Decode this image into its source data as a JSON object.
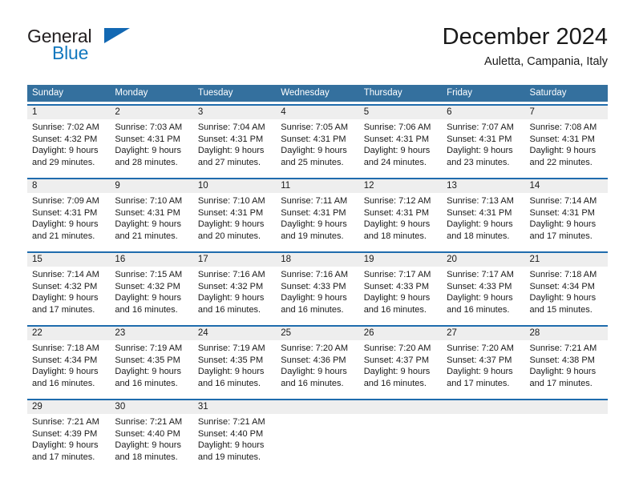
{
  "brand": {
    "name_part1": "General",
    "name_part2": "Blue",
    "accent_color": "#1278be",
    "triangle_color": "#1268b3"
  },
  "header": {
    "title": "December 2024",
    "location": "Auletta, Campania, Italy"
  },
  "theme": {
    "header_bg": "#34709e",
    "week_border": "#1f6cad",
    "daynum_bg": "#eeeeee"
  },
  "weekday_headers": [
    "Sunday",
    "Monday",
    "Tuesday",
    "Wednesday",
    "Thursday",
    "Friday",
    "Saturday"
  ],
  "weeks": [
    {
      "days": [
        {
          "num": "1",
          "sunrise": "Sunrise: 7:02 AM",
          "sunset": "Sunset: 4:32 PM",
          "daylight1": "Daylight: 9 hours",
          "daylight2": "and 29 minutes."
        },
        {
          "num": "2",
          "sunrise": "Sunrise: 7:03 AM",
          "sunset": "Sunset: 4:31 PM",
          "daylight1": "Daylight: 9 hours",
          "daylight2": "and 28 minutes."
        },
        {
          "num": "3",
          "sunrise": "Sunrise: 7:04 AM",
          "sunset": "Sunset: 4:31 PM",
          "daylight1": "Daylight: 9 hours",
          "daylight2": "and 27 minutes."
        },
        {
          "num": "4",
          "sunrise": "Sunrise: 7:05 AM",
          "sunset": "Sunset: 4:31 PM",
          "daylight1": "Daylight: 9 hours",
          "daylight2": "and 25 minutes."
        },
        {
          "num": "5",
          "sunrise": "Sunrise: 7:06 AM",
          "sunset": "Sunset: 4:31 PM",
          "daylight1": "Daylight: 9 hours",
          "daylight2": "and 24 minutes."
        },
        {
          "num": "6",
          "sunrise": "Sunrise: 7:07 AM",
          "sunset": "Sunset: 4:31 PM",
          "daylight1": "Daylight: 9 hours",
          "daylight2": "and 23 minutes."
        },
        {
          "num": "7",
          "sunrise": "Sunrise: 7:08 AM",
          "sunset": "Sunset: 4:31 PM",
          "daylight1": "Daylight: 9 hours",
          "daylight2": "and 22 minutes."
        }
      ]
    },
    {
      "days": [
        {
          "num": "8",
          "sunrise": "Sunrise: 7:09 AM",
          "sunset": "Sunset: 4:31 PM",
          "daylight1": "Daylight: 9 hours",
          "daylight2": "and 21 minutes."
        },
        {
          "num": "9",
          "sunrise": "Sunrise: 7:10 AM",
          "sunset": "Sunset: 4:31 PM",
          "daylight1": "Daylight: 9 hours",
          "daylight2": "and 21 minutes."
        },
        {
          "num": "10",
          "sunrise": "Sunrise: 7:10 AM",
          "sunset": "Sunset: 4:31 PM",
          "daylight1": "Daylight: 9 hours",
          "daylight2": "and 20 minutes."
        },
        {
          "num": "11",
          "sunrise": "Sunrise: 7:11 AM",
          "sunset": "Sunset: 4:31 PM",
          "daylight1": "Daylight: 9 hours",
          "daylight2": "and 19 minutes."
        },
        {
          "num": "12",
          "sunrise": "Sunrise: 7:12 AM",
          "sunset": "Sunset: 4:31 PM",
          "daylight1": "Daylight: 9 hours",
          "daylight2": "and 18 minutes."
        },
        {
          "num": "13",
          "sunrise": "Sunrise: 7:13 AM",
          "sunset": "Sunset: 4:31 PM",
          "daylight1": "Daylight: 9 hours",
          "daylight2": "and 18 minutes."
        },
        {
          "num": "14",
          "sunrise": "Sunrise: 7:14 AM",
          "sunset": "Sunset: 4:31 PM",
          "daylight1": "Daylight: 9 hours",
          "daylight2": "and 17 minutes."
        }
      ]
    },
    {
      "days": [
        {
          "num": "15",
          "sunrise": "Sunrise: 7:14 AM",
          "sunset": "Sunset: 4:32 PM",
          "daylight1": "Daylight: 9 hours",
          "daylight2": "and 17 minutes."
        },
        {
          "num": "16",
          "sunrise": "Sunrise: 7:15 AM",
          "sunset": "Sunset: 4:32 PM",
          "daylight1": "Daylight: 9 hours",
          "daylight2": "and 16 minutes."
        },
        {
          "num": "17",
          "sunrise": "Sunrise: 7:16 AM",
          "sunset": "Sunset: 4:32 PM",
          "daylight1": "Daylight: 9 hours",
          "daylight2": "and 16 minutes."
        },
        {
          "num": "18",
          "sunrise": "Sunrise: 7:16 AM",
          "sunset": "Sunset: 4:33 PM",
          "daylight1": "Daylight: 9 hours",
          "daylight2": "and 16 minutes."
        },
        {
          "num": "19",
          "sunrise": "Sunrise: 7:17 AM",
          "sunset": "Sunset: 4:33 PM",
          "daylight1": "Daylight: 9 hours",
          "daylight2": "and 16 minutes."
        },
        {
          "num": "20",
          "sunrise": "Sunrise: 7:17 AM",
          "sunset": "Sunset: 4:33 PM",
          "daylight1": "Daylight: 9 hours",
          "daylight2": "and 16 minutes."
        },
        {
          "num": "21",
          "sunrise": "Sunrise: 7:18 AM",
          "sunset": "Sunset: 4:34 PM",
          "daylight1": "Daylight: 9 hours",
          "daylight2": "and 15 minutes."
        }
      ]
    },
    {
      "days": [
        {
          "num": "22",
          "sunrise": "Sunrise: 7:18 AM",
          "sunset": "Sunset: 4:34 PM",
          "daylight1": "Daylight: 9 hours",
          "daylight2": "and 16 minutes."
        },
        {
          "num": "23",
          "sunrise": "Sunrise: 7:19 AM",
          "sunset": "Sunset: 4:35 PM",
          "daylight1": "Daylight: 9 hours",
          "daylight2": "and 16 minutes."
        },
        {
          "num": "24",
          "sunrise": "Sunrise: 7:19 AM",
          "sunset": "Sunset: 4:35 PM",
          "daylight1": "Daylight: 9 hours",
          "daylight2": "and 16 minutes."
        },
        {
          "num": "25",
          "sunrise": "Sunrise: 7:20 AM",
          "sunset": "Sunset: 4:36 PM",
          "daylight1": "Daylight: 9 hours",
          "daylight2": "and 16 minutes."
        },
        {
          "num": "26",
          "sunrise": "Sunrise: 7:20 AM",
          "sunset": "Sunset: 4:37 PM",
          "daylight1": "Daylight: 9 hours",
          "daylight2": "and 16 minutes."
        },
        {
          "num": "27",
          "sunrise": "Sunrise: 7:20 AM",
          "sunset": "Sunset: 4:37 PM",
          "daylight1": "Daylight: 9 hours",
          "daylight2": "and 17 minutes."
        },
        {
          "num": "28",
          "sunrise": "Sunrise: 7:21 AM",
          "sunset": "Sunset: 4:38 PM",
          "daylight1": "Daylight: 9 hours",
          "daylight2": "and 17 minutes."
        }
      ]
    },
    {
      "days": [
        {
          "num": "29",
          "sunrise": "Sunrise: 7:21 AM",
          "sunset": "Sunset: 4:39 PM",
          "daylight1": "Daylight: 9 hours",
          "daylight2": "and 17 minutes."
        },
        {
          "num": "30",
          "sunrise": "Sunrise: 7:21 AM",
          "sunset": "Sunset: 4:40 PM",
          "daylight1": "Daylight: 9 hours",
          "daylight2": "and 18 minutes."
        },
        {
          "num": "31",
          "sunrise": "Sunrise: 7:21 AM",
          "sunset": "Sunset: 4:40 PM",
          "daylight1": "Daylight: 9 hours",
          "daylight2": "and 19 minutes."
        },
        {
          "num": "",
          "sunrise": "",
          "sunset": "",
          "daylight1": "",
          "daylight2": ""
        },
        {
          "num": "",
          "sunrise": "",
          "sunset": "",
          "daylight1": "",
          "daylight2": ""
        },
        {
          "num": "",
          "sunrise": "",
          "sunset": "",
          "daylight1": "",
          "daylight2": ""
        },
        {
          "num": "",
          "sunrise": "",
          "sunset": "",
          "daylight1": "",
          "daylight2": ""
        }
      ]
    }
  ]
}
